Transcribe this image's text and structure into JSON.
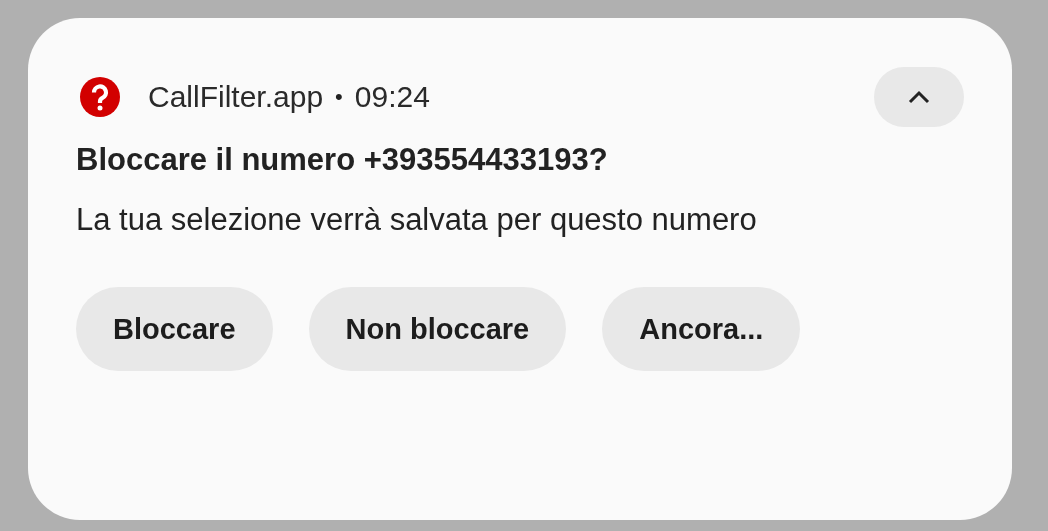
{
  "notification": {
    "app_name": "CallFilter.app",
    "separator": "•",
    "time": "09:24",
    "expanded": true,
    "title": "Bloccare il numero +393554433193?",
    "body": "La tua selezione verrà salvata per questo numero"
  },
  "actions": [
    "Bloccare",
    "Non bloccare",
    "Ancora..."
  ]
}
